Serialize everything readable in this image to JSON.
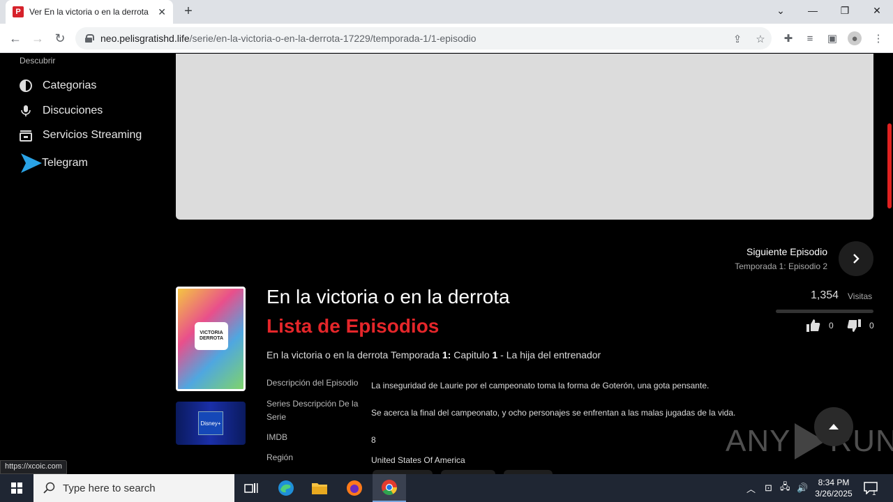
{
  "browser": {
    "tab_title": "Ver En la victoria o en la derrota",
    "url_host": "neo.pelisgratishd.life",
    "url_path": "/serie/en-la-victoria-o-en-la-derrota-17229/temporada-1/1-episodio",
    "status_url": "https://xcoic.com"
  },
  "sidebar": {
    "heading": "Descubrir",
    "items": [
      {
        "label": "Categorias",
        "icon": "half-circle-icon"
      },
      {
        "label": "Discuciones",
        "icon": "microphone-icon"
      },
      {
        "label": "Servicios Streaming",
        "icon": "tv-icon"
      },
      {
        "label": "Telegram",
        "icon": "telegram-icon"
      }
    ]
  },
  "next_episode": {
    "title": "Siguiente Episodio",
    "subtitle": "Temporada 1: Episodio 2"
  },
  "show": {
    "title": "En la victoria o en la derrota",
    "list_title": "Lista de Episodios",
    "episode_prefix": "En la victoria o en la derrota Temporada ",
    "season": "1:",
    "chapter_label": " Capitulo ",
    "chapter": "1",
    "episode_suffix": " - La hija del entrenador",
    "poster_text": "VICTORIA DERROTA",
    "provider_text": "Disney+"
  },
  "info": [
    {
      "label": "Descripción del Episodio",
      "value": "La inseguridad de Laurie por el campeonato toma la forma de Goterón, una gota pensante."
    },
    {
      "label": "Series Descripción De la Serie",
      "value": "Se acerca la final del campeonato, y ocho personajes se enfrentan a las malas jugadas de la vida."
    },
    {
      "label": "IMDB",
      "value": "8"
    },
    {
      "label": "Región",
      "value": "United States Of America"
    }
  ],
  "stats": {
    "views": "1,354",
    "views_label": "Visitas",
    "likes": "0",
    "dislikes": "0"
  },
  "watermark": {
    "left": "ANY",
    "right": "RUN"
  },
  "taskbar": {
    "search_placeholder": "Type here to search",
    "time": "8:34 PM",
    "date": "3/26/2025",
    "notification_count": "1"
  },
  "colors": {
    "accent": "#e5262a",
    "player_bg": "#dcdcdc",
    "telegram": "#2aa3e6"
  }
}
